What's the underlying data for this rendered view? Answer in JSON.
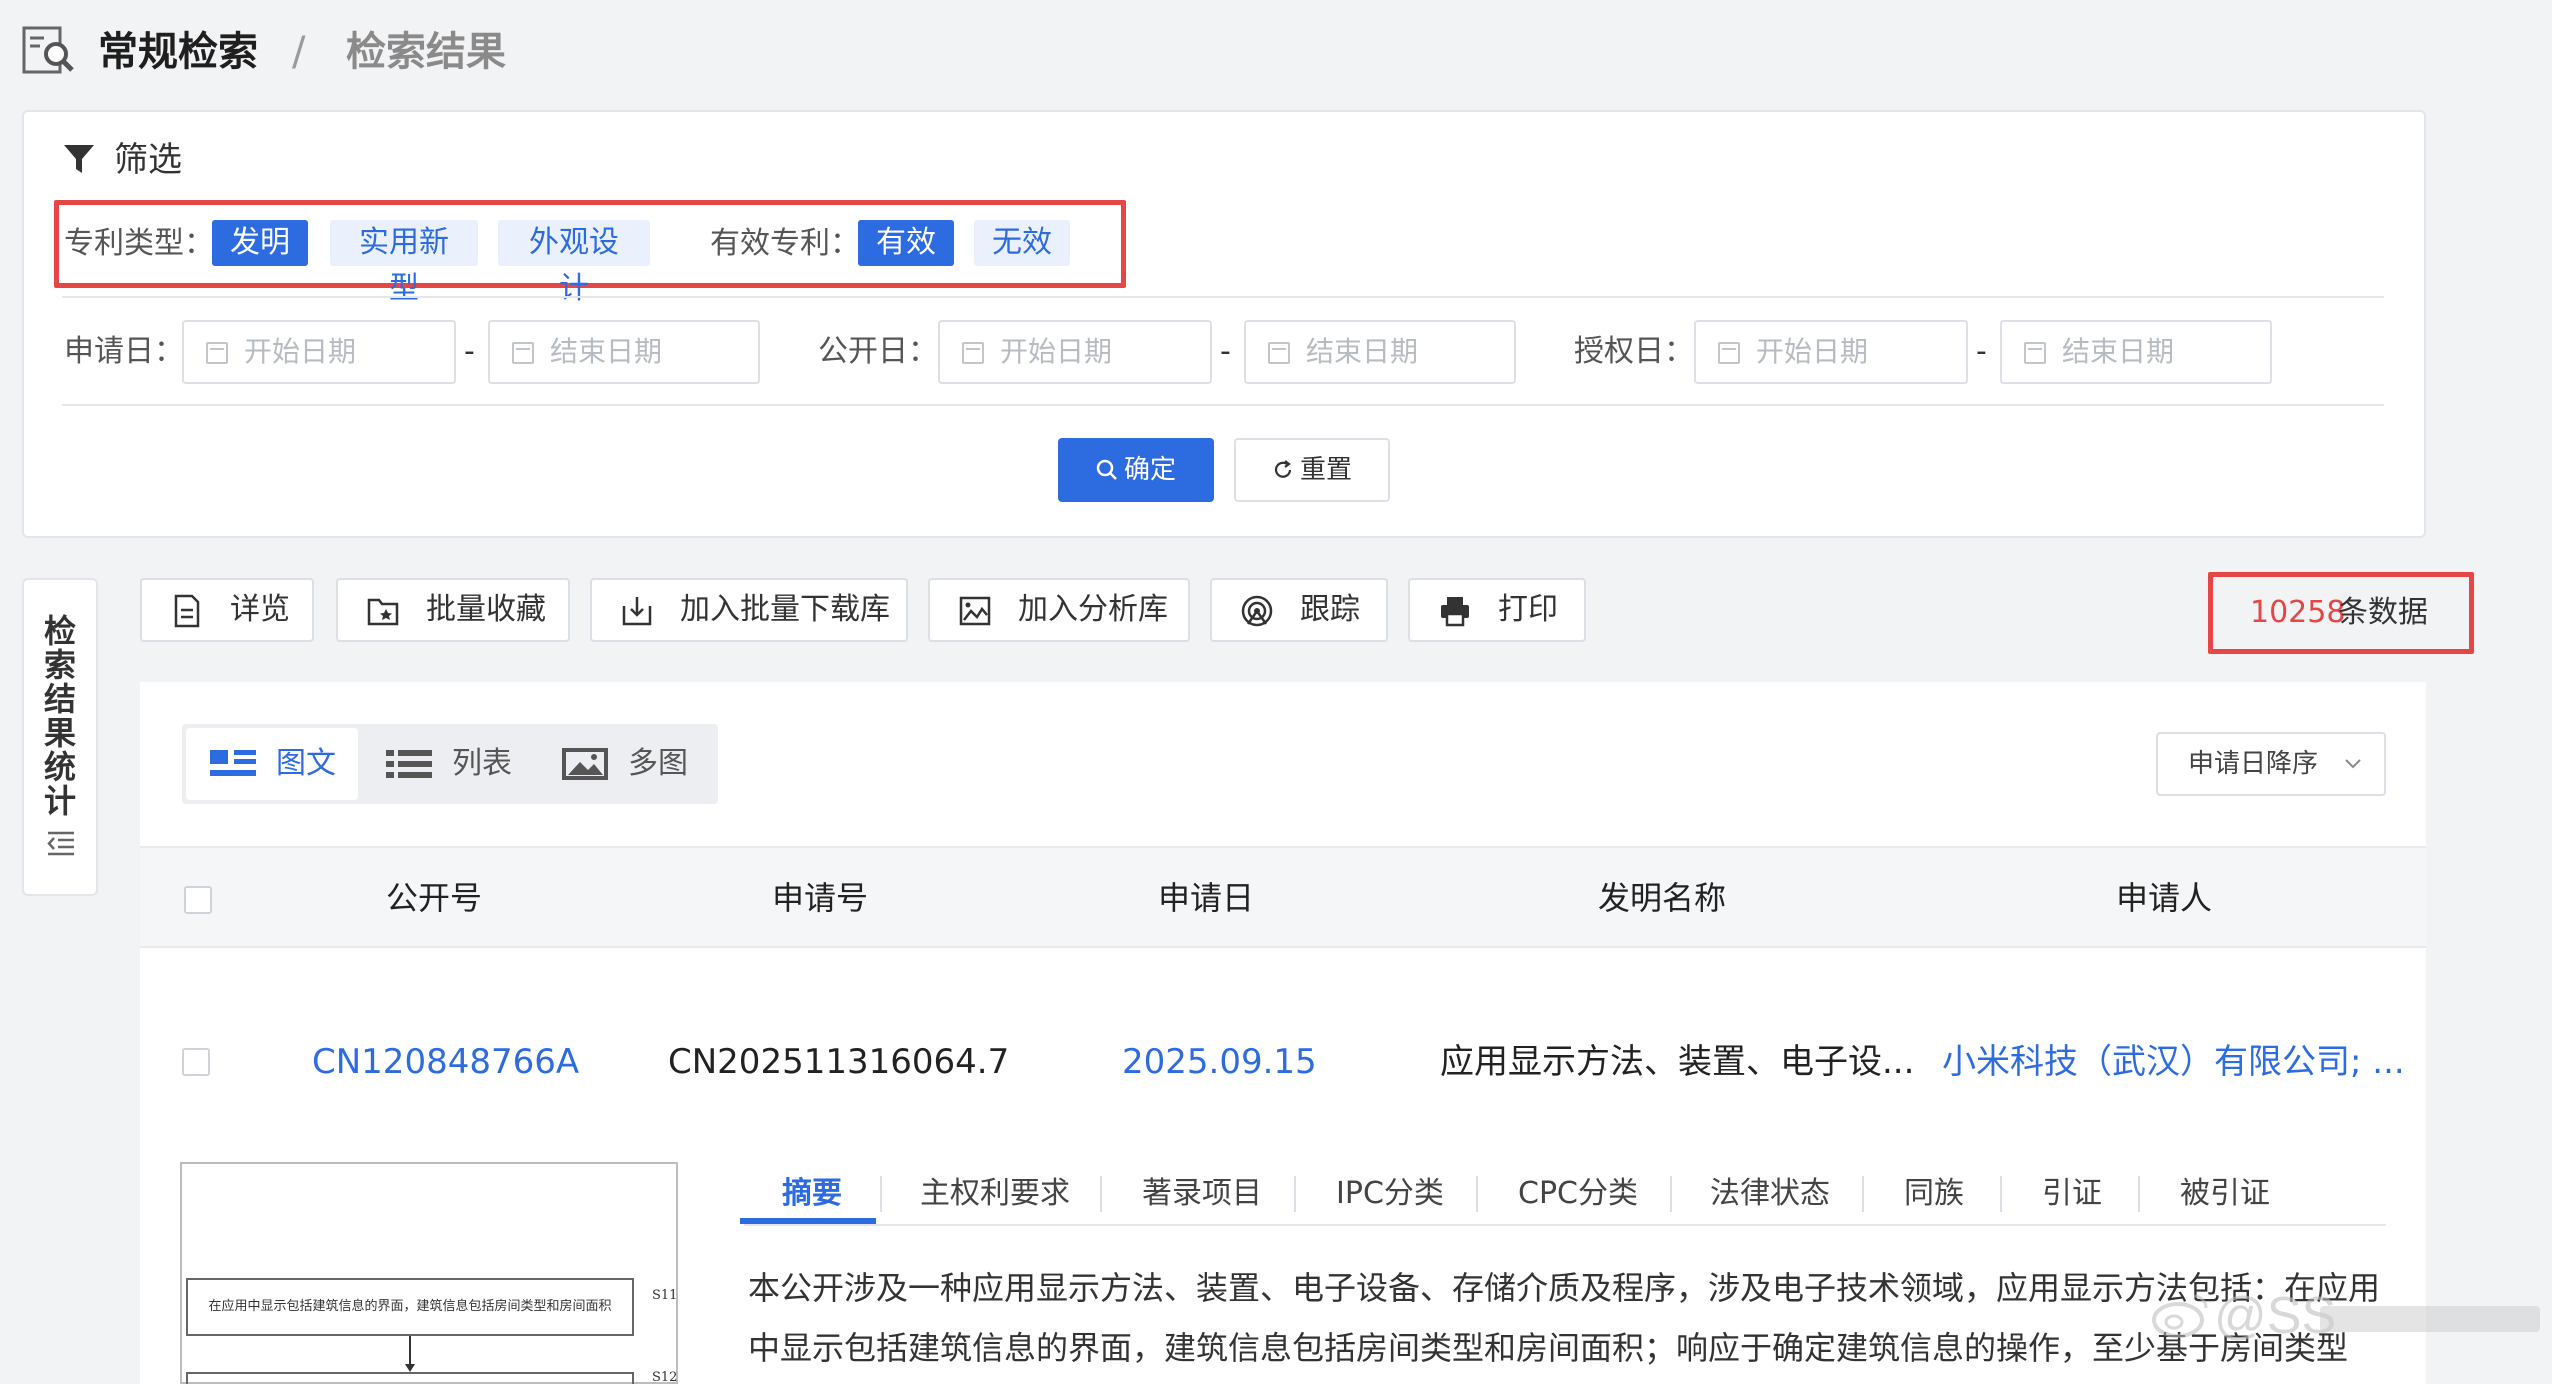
{
  "breadcrumb": {
    "icon": "document-search-icon",
    "level1": "常规检索",
    "separator": "/",
    "level2": "检索结果"
  },
  "filter": {
    "title": "筛选",
    "patent_type_label": "专利类型：",
    "patent_types": [
      "发明",
      "实用新型",
      "外观设计"
    ],
    "patent_type_selected": "发明",
    "valid_label": "有效专利：",
    "valid_options": [
      "有效",
      "无效"
    ],
    "valid_selected": "有效",
    "apply_date_label": "申请日：",
    "pub_date_label": "公开日：",
    "grant_date_label": "授权日：",
    "start_placeholder": "开始日期",
    "end_placeholder": "结束日期",
    "range_dash": "-",
    "confirm_label": "确定",
    "reset_label": "重置"
  },
  "side_tab": {
    "label": "检索结果统计"
  },
  "toolbar": {
    "buttons": [
      {
        "label": "详览",
        "icon": "document-icon"
      },
      {
        "label": "批量收藏",
        "icon": "bookmark-folder-icon"
      },
      {
        "label": "加入批量下载库",
        "icon": "download-icon"
      },
      {
        "label": "加入分析库",
        "icon": "image-chart-icon"
      },
      {
        "label": "跟踪",
        "icon": "radar-icon"
      },
      {
        "label": "打印",
        "icon": "printer-icon"
      }
    ],
    "count_number": "10258",
    "count_suffix": "条数据"
  },
  "views": {
    "items": [
      "图文",
      "列表",
      "多图"
    ],
    "selected": "图文",
    "sort_label": "申请日降序"
  },
  "table": {
    "headers": [
      "公开号",
      "申请号",
      "申请日",
      "发明名称",
      "申请人"
    ],
    "rows": [
      {
        "pub_no": "CN120848766A",
        "app_no": "CN202511316064.7",
        "app_date": "2025.09.15",
        "title": "应用显示方法、装置、电子设...",
        "applicant": "小米科技（武汉）有限公司; ..."
      }
    ]
  },
  "thumbnail": {
    "step1_text": "在应用中显示包括建筑信息的界面，建筑信息包括房间类型和房间面积",
    "step1_tag": "S11",
    "step2_tag": "S12"
  },
  "detail_tabs": {
    "items": [
      "摘要",
      "主权利要求",
      "著录项目",
      "IPC分类",
      "CPC分类",
      "法律状态",
      "同族",
      "引证",
      "被引证"
    ],
    "selected": "摘要"
  },
  "abstract": {
    "text": "本公开涉及一种应用显示方法、装置、电子设备、存储介质及程序，涉及电子技术领域，应用显示方法包括：在应用中显示包括建筑信息的界面，建筑信息包括房间类型和房间面积；响应于确定建筑信息的操作，至少基于房间类型"
  },
  "colors": {
    "primary": "#2d6be0",
    "highlight_red": "#e54646",
    "chip_bg": "#eaf1fd"
  },
  "watermark": {
    "text": "@SS"
  }
}
